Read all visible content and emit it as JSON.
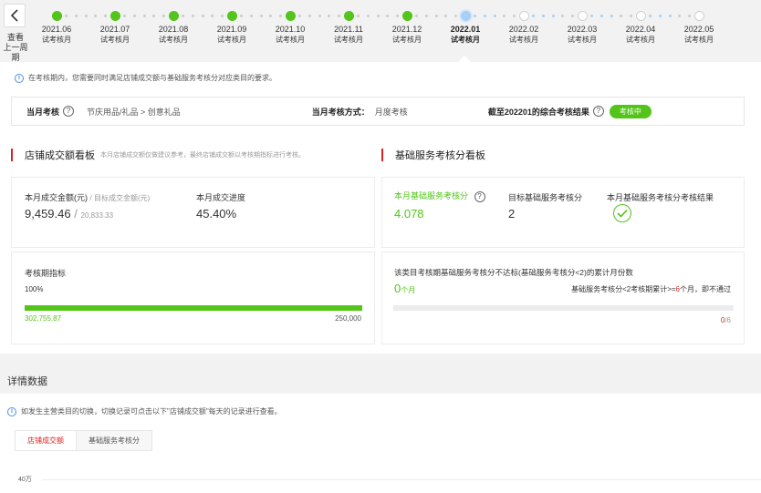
{
  "timeline": {
    "prev_label_1": "查看",
    "prev_label_2": "上一周期",
    "items": [
      {
        "date": "2021.06",
        "status": "试考核月",
        "state": "done"
      },
      {
        "date": "2021.07",
        "status": "试考核月",
        "state": "done"
      },
      {
        "date": "2021.08",
        "status": "试考核月",
        "state": "done"
      },
      {
        "date": "2021.09",
        "status": "试考核月",
        "state": "done"
      },
      {
        "date": "2021.10",
        "status": "试考核月",
        "state": "done"
      },
      {
        "date": "2021.11",
        "status": "试考核月",
        "state": "done"
      },
      {
        "date": "2021.12",
        "status": "试考核月",
        "state": "done"
      },
      {
        "date": "2022.01",
        "status": "试考核月",
        "state": "current"
      },
      {
        "date": "2022.02",
        "status": "试考核月",
        "state": "future"
      },
      {
        "date": "2022.03",
        "status": "试考核月",
        "state": "future"
      },
      {
        "date": "2022.04",
        "status": "试考核月",
        "state": "future"
      },
      {
        "date": "2022.05",
        "status": "试考核月",
        "state": "future"
      }
    ]
  },
  "notice_top": "在考核期内，您需要同时满足店铺成交额与基础服务考核分对应类目的要求。",
  "info_bar": {
    "assess_label": "当月考核",
    "assess_value": "节庆用品/礼品 > 创意礼品",
    "method_label": "当月考核方式：",
    "method_value": "月度考核",
    "result_label": "截至202201的综合考核结果",
    "result_badge": "考核中"
  },
  "sales_board": {
    "title": "店铺成交额看板",
    "note": "本月店铺成交额仅做建议参考，最终店铺成交额以考核期指标进行考核。",
    "amount_label": "本月成交金额(元)",
    "target_label": "/ 目标成交金额(元)",
    "amount_value": "9,459.46",
    "target_value": "20,833.33",
    "progress_label": "本月成交进度",
    "progress_value": "45.40%",
    "period_label": "考核期指标",
    "period_percent": "100%",
    "period_progress": 1.0,
    "period_actual": "302,755.87",
    "period_target": "250,000"
  },
  "service_board": {
    "title": "基础服务考核分看板",
    "score_label": "本月基础服务考核分",
    "score_value": "4.078",
    "target_label": "目标基础服务考核分",
    "target_value": "2",
    "result_label": "本月基础服务考核分考核结果",
    "fail_label": "该类目考核期基础服务考核分不达标(基础服务考核分<2)的累计月份数",
    "fail_value": "0",
    "fail_unit": "个月",
    "rule_prefix": "基础服务考核分<2考核期累计>=",
    "rule_num": "6",
    "rule_suffix": "个月，即不通过",
    "fail_count": "0",
    "fail_total": "/6",
    "fail_progress": 0.0
  },
  "details": {
    "title": "详情数据",
    "notice": "如发生主营类目的切换，切换记录可点击以下\"店铺成交额\"每天的记录进行查看。",
    "tabs": [
      "店铺成交额",
      "基础服务考核分"
    ],
    "axis_label": "40万"
  },
  "colors": {
    "green": "#52c41a",
    "red": "#e02020",
    "blue": "#4a90e2"
  }
}
